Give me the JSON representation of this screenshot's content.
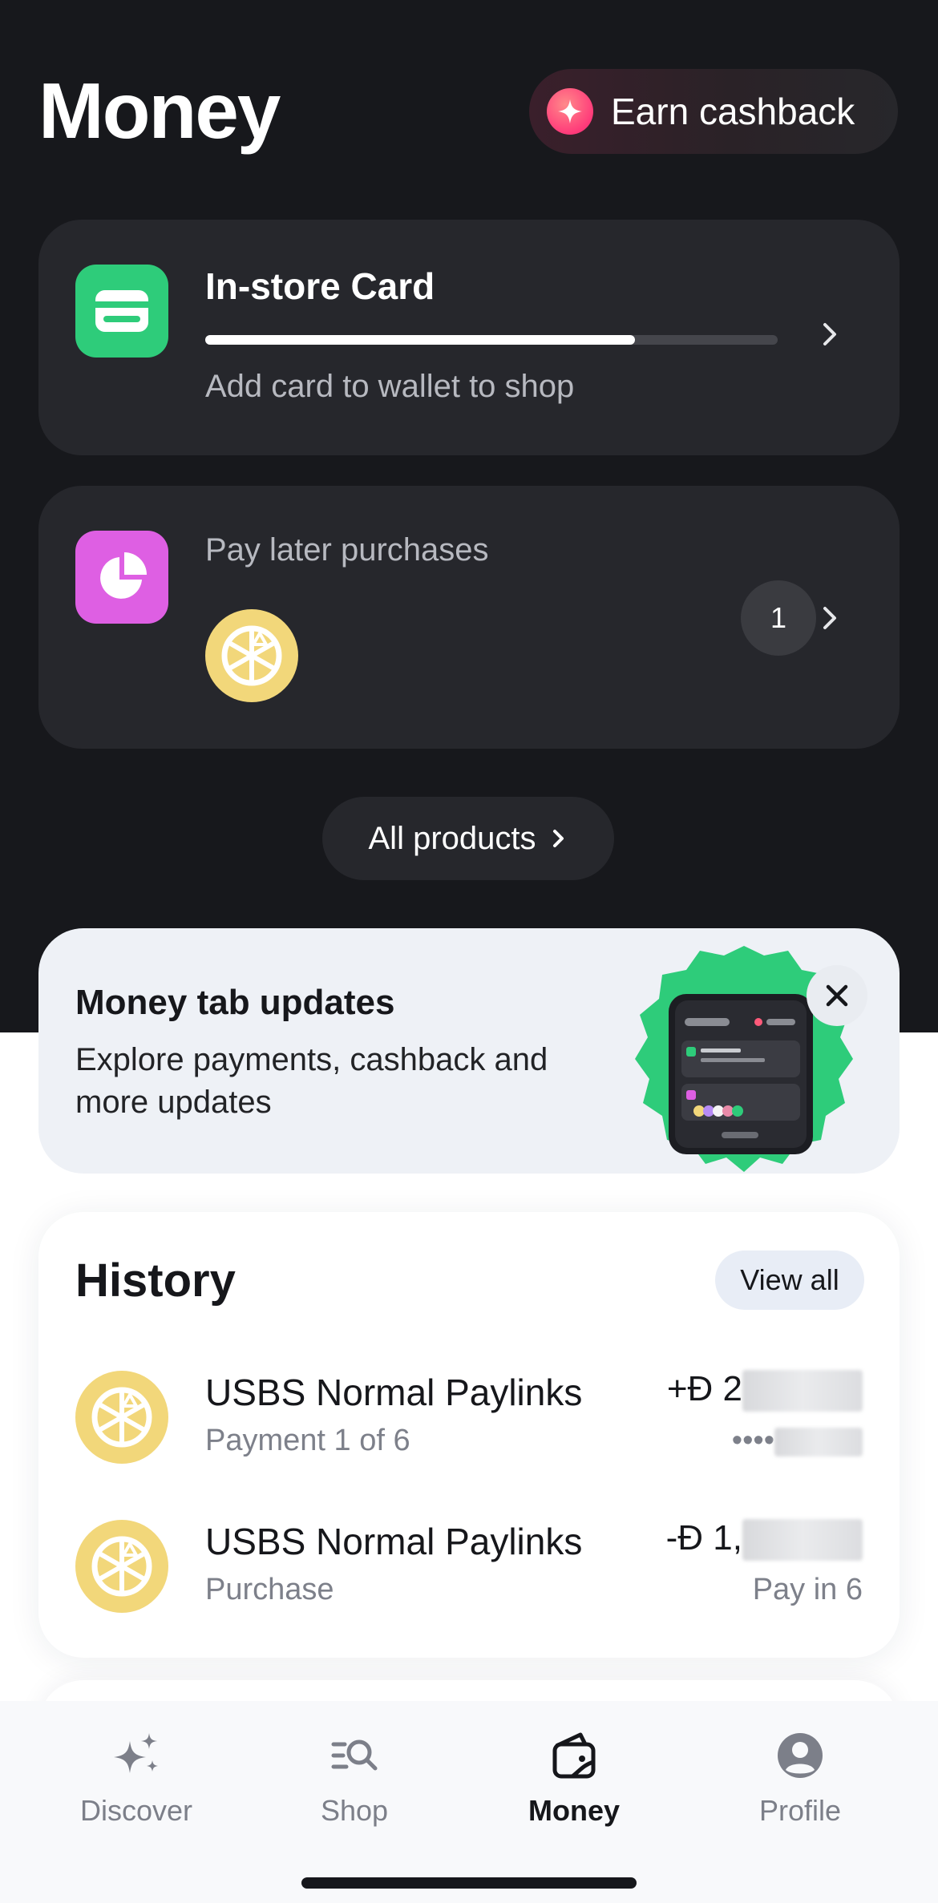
{
  "header": {
    "title": "Money",
    "cashback_button": "Earn cashback"
  },
  "in_store_card": {
    "title": "In-store Card",
    "subtitle": "Add card to wallet to shop",
    "progress": 0.75
  },
  "pay_later": {
    "title": "Pay later purchases",
    "count": "1"
  },
  "all_products": "All products",
  "updates": {
    "title": "Money tab updates",
    "body": "Explore payments, cashback and more updates"
  },
  "history": {
    "title": "History",
    "view_all": "View all",
    "items": [
      {
        "name": "USBS Normal Paylinks",
        "sub": "Payment 1 of 6",
        "amount": "+Ð 2",
        "right_sub": "••••"
      },
      {
        "name": "USBS Normal Paylinks",
        "sub": "Purchase",
        "amount": "-Ð 1,",
        "right_sub": "Pay in 6"
      }
    ]
  },
  "tabs": [
    {
      "label": "Discover",
      "icon": "sparkles-icon",
      "active": false
    },
    {
      "label": "Shop",
      "icon": "search-list-icon",
      "active": false
    },
    {
      "label": "Money",
      "icon": "wallet-icon",
      "active": true
    },
    {
      "label": "Profile",
      "icon": "profile-icon",
      "active": false
    }
  ],
  "colors": {
    "dark_bg": "#17181c",
    "card_bg": "#26272c",
    "green": "#2ecc7a",
    "pink": "#de5fe3",
    "merchant_yellow": "#f2d77a"
  }
}
